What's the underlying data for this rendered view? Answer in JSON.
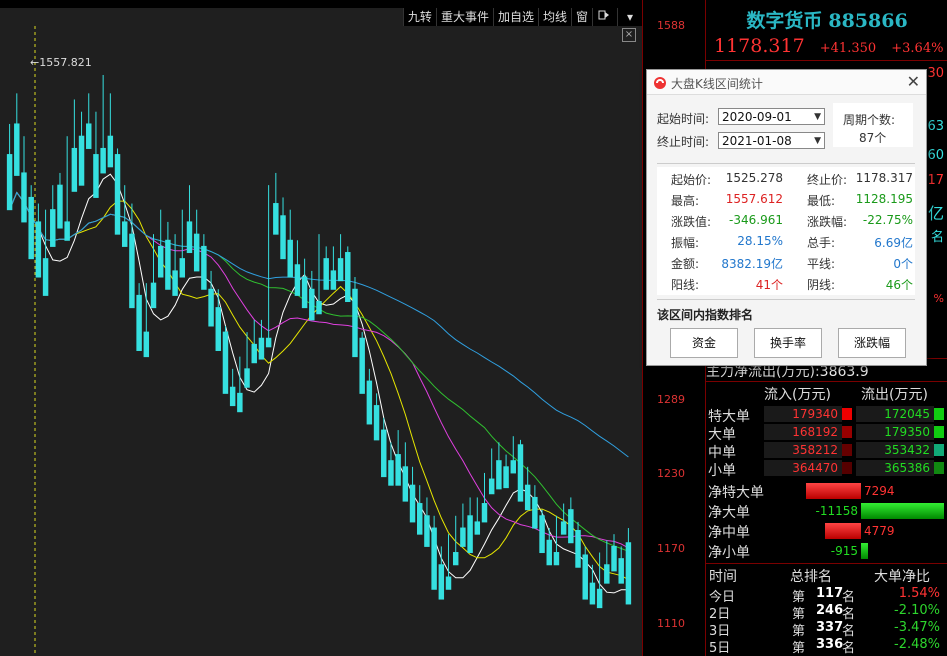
{
  "toolbar": {
    "items": [
      "九转",
      "重大事件",
      "加自选",
      "均线",
      "窗"
    ],
    "icon_more": "arrow-menu-icon",
    "close": "×"
  },
  "chart": {
    "high_marker": "1557.821",
    "price_labels": [
      "1588",
      "1289",
      "1230",
      "1170",
      "1110"
    ],
    "colors": {
      "up": "#ff3030",
      "down": "#36e0e0",
      "ma5": "#ffffff",
      "ma10": "#e6e600",
      "ma20": "#e040e0",
      "ma30": "#30c030",
      "ma60": "#30a0e0"
    }
  },
  "chart_data": {
    "type": "candlestick",
    "ylim": [
      1110,
      1600
    ],
    "yticks": [
      1588,
      1289,
      1230,
      1170,
      1110
    ],
    "annotations": [
      "1557.821"
    ],
    "candles": [
      [
        1495,
        1520,
        1460,
        1450
      ],
      [
        1520,
        1545,
        1500,
        1478
      ],
      [
        1480,
        1510,
        1450,
        1440
      ],
      [
        1460,
        1470,
        1420,
        1410
      ],
      [
        1440,
        1455,
        1405,
        1395
      ],
      [
        1410,
        1450,
        1400,
        1380
      ],
      [
        1450,
        1470,
        1430,
        1420
      ],
      [
        1470,
        1480,
        1440,
        1435
      ],
      [
        1440,
        1510,
        1430,
        1425
      ],
      [
        1500,
        1540,
        1470,
        1465
      ],
      [
        1510,
        1530,
        1475,
        1470
      ],
      [
        1520,
        1545,
        1505,
        1500
      ],
      [
        1495,
        1530,
        1470,
        1460
      ],
      [
        1500,
        1560,
        1490,
        1480
      ],
      [
        1510,
        1545,
        1495,
        1485
      ],
      [
        1495,
        1500,
        1440,
        1430
      ],
      [
        1440,
        1470,
        1430,
        1420
      ],
      [
        1430,
        1455,
        1380,
        1370
      ],
      [
        1380,
        1390,
        1345,
        1335
      ],
      [
        1350,
        1390,
        1340,
        1330
      ],
      [
        1390,
        1430,
        1380,
        1370
      ],
      [
        1420,
        1450,
        1405,
        1395
      ],
      [
        1425,
        1440,
        1395,
        1385
      ],
      [
        1400,
        1430,
        1390,
        1380
      ],
      [
        1410,
        1450,
        1400,
        1395
      ],
      [
        1440,
        1470,
        1420,
        1415
      ],
      [
        1430,
        1450,
        1410,
        1400
      ],
      [
        1420,
        1430,
        1395,
        1385
      ],
      [
        1385,
        1400,
        1370,
        1355
      ],
      [
        1370,
        1385,
        1345,
        1335
      ],
      [
        1350,
        1355,
        1315,
        1300
      ],
      [
        1305,
        1320,
        1300,
        1290
      ],
      [
        1300,
        1330,
        1295,
        1285
      ],
      [
        1320,
        1350,
        1310,
        1305
      ],
      [
        1340,
        1360,
        1330,
        1325
      ],
      [
        1345,
        1360,
        1335,
        1328
      ],
      [
        1345,
        1470,
        1345,
        1338
      ],
      [
        1455,
        1480,
        1435,
        1430
      ],
      [
        1445,
        1460,
        1420,
        1410
      ],
      [
        1425,
        1450,
        1405,
        1395
      ],
      [
        1405,
        1425,
        1390,
        1380
      ],
      [
        1395,
        1410,
        1380,
        1370
      ],
      [
        1385,
        1400,
        1370,
        1360
      ],
      [
        1375,
        1430,
        1370,
        1365
      ],
      [
        1410,
        1420,
        1395,
        1385
      ],
      [
        1400,
        1420,
        1395,
        1385
      ],
      [
        1410,
        1430,
        1400,
        1392
      ],
      [
        1415,
        1420,
        1385,
        1375
      ],
      [
        1385,
        1395,
        1340,
        1330
      ],
      [
        1345,
        1350,
        1310,
        1300
      ],
      [
        1310,
        1320,
        1285,
        1275
      ],
      [
        1290,
        1300,
        1270,
        1262
      ],
      [
        1270,
        1280,
        1240,
        1232
      ],
      [
        1245,
        1260,
        1235,
        1225
      ],
      [
        1250,
        1270,
        1230,
        1225
      ],
      [
        1240,
        1260,
        1220,
        1212
      ],
      [
        1225,
        1240,
        1205,
        1195
      ],
      [
        1210,
        1225,
        1190,
        1185
      ],
      [
        1200,
        1215,
        1185,
        1175
      ],
      [
        1190,
        1200,
        1150,
        1140
      ],
      [
        1160,
        1175,
        1140,
        1132
      ],
      [
        1150,
        1185,
        1145,
        1140
      ],
      [
        1170,
        1200,
        1165,
        1160
      ],
      [
        1190,
        1210,
        1180,
        1175
      ],
      [
        1200,
        1215,
        1180,
        1170
      ],
      [
        1195,
        1215,
        1190,
        1185
      ],
      [
        1210,
        1235,
        1200,
        1195
      ],
      [
        1230,
        1255,
        1225,
        1218
      ],
      [
        1245,
        1260,
        1230,
        1222
      ],
      [
        1240,
        1250,
        1230,
        1223
      ],
      [
        1245,
        1265,
        1240,
        1235
      ],
      [
        1258,
        1262,
        1220,
        1212
      ],
      [
        1225,
        1240,
        1210,
        1205
      ],
      [
        1215,
        1225,
        1195,
        1190
      ],
      [
        1200,
        1205,
        1175,
        1170
      ],
      [
        1180,
        1190,
        1165,
        1160
      ],
      [
        1170,
        1200,
        1165,
        1160
      ],
      [
        1195,
        1210,
        1190,
        1185
      ],
      [
        1205,
        1215,
        1185,
        1178
      ],
      [
        1188,
        1195,
        1165,
        1158
      ],
      [
        1168,
        1175,
        1140,
        1132
      ],
      [
        1145,
        1160,
        1135,
        1128
      ],
      [
        1140,
        1170,
        1130,
        1125
      ],
      [
        1160,
        1180,
        1150,
        1145
      ],
      [
        1175,
        1185,
        1160,
        1155
      ],
      [
        1165,
        1175,
        1150,
        1145
      ],
      [
        1178,
        1190,
        1130,
        1128
      ]
    ]
  },
  "right": {
    "stock_name": "数字货币",
    "stock_code": "885866",
    "last_price": "1178.317",
    "change_abs": "+41.350",
    "change_pct": "+3.64%",
    "partial_values": [
      {
        "text": "30",
        "color": "#ff3333"
      },
      {
        "text": "363",
        "color": "#36e0e0"
      },
      {
        "text": "60",
        "color": "#36e0e0"
      },
      {
        "text": "17",
        "color": "#ff3333"
      },
      {
        "text": "亿",
        "color": "#36e0e0"
      },
      {
        "text": "名",
        "color": "#36e0e0"
      },
      {
        "text": "%",
        "color": "#ff3333"
      }
    ],
    "main_flow_label": "主力净流出(万元)",
    "main_flow_value": "3863.9",
    "flow_headers": [
      "流入(万元)",
      "流出(万元)"
    ],
    "flow_rows": [
      {
        "label": "特大单",
        "in": "179340",
        "out": "172045"
      },
      {
        "label": "大单",
        "in": "168192",
        "out": "179350"
      },
      {
        "label": "中单",
        "in": "358212",
        "out": "353432"
      },
      {
        "label": "小单",
        "in": "364470",
        "out": "365386"
      }
    ],
    "net_rows": [
      {
        "label": "净特大单",
        "value": "7294",
        "sign": "pos",
        "bar": 55
      },
      {
        "label": "净大单",
        "value": "-11158",
        "sign": "neg",
        "bar": 88
      },
      {
        "label": "净中单",
        "value": "4779",
        "sign": "pos",
        "bar": 36
      },
      {
        "label": "净小单",
        "value": "-915",
        "sign": "neg",
        "bar": 7
      }
    ],
    "rank_headers": [
      "时间",
      "总排名",
      "大单净比"
    ],
    "rank_rows": [
      {
        "day": "今日",
        "prefix": "第",
        "rank": "117",
        "suffix": "名",
        "ratio": "1.54%",
        "ratio_color": "#ff3333"
      },
      {
        "day": "2日",
        "prefix": "第",
        "rank": "246",
        "suffix": "名",
        "ratio": "-2.10%",
        "ratio_color": "#2dd52d"
      },
      {
        "day": "3日",
        "prefix": "第",
        "rank": "337",
        "suffix": "名",
        "ratio": "-3.47%",
        "ratio_color": "#2dd52d"
      },
      {
        "day": "5日",
        "prefix": "第",
        "rank": "336",
        "suffix": "名",
        "ratio": "-2.48%",
        "ratio_color": "#2dd52d"
      }
    ]
  },
  "dialog": {
    "title": "大盘K线区间统计",
    "start_label": "起始时间:",
    "start_value": "2020-09-01",
    "end_label": "终止时间:",
    "end_value": "2021-01-08",
    "count_label": "周期个数:",
    "count_value": "87个",
    "stats": [
      {
        "l1": "起始价:",
        "v1": "1525.278",
        "c1": "#333333",
        "l2": "终止价:",
        "v2": "1178.317",
        "c2": "#333333"
      },
      {
        "l1": "最高:",
        "v1": "1557.612",
        "c1": "#dd2222",
        "l2": "最低:",
        "v2": "1128.195",
        "c2": "#1a9a1a"
      },
      {
        "l1": "涨跌值:",
        "v1": "-346.961",
        "c1": "#1a9a1a",
        "l2": "涨跌幅:",
        "v2": "-22.75%",
        "c2": "#1a9a1a"
      },
      {
        "l1": "振幅:",
        "v1": "28.15%",
        "c1": "#2277cc",
        "l2": "总手:",
        "v2": "6.69亿",
        "c2": "#2277cc"
      },
      {
        "l1": "金额:",
        "v1": "8382.19亿",
        "c1": "#2277cc",
        "l2": "平线:",
        "v2": "0个",
        "c2": "#2277cc"
      },
      {
        "l1": "阳线:",
        "v1": "41个",
        "c1": "#dd2222",
        "l2": "阴线:",
        "v2": "46个",
        "c2": "#1a9a1a"
      }
    ],
    "rank_title": "该区间内指数排名",
    "buttons": [
      "资金",
      "换手率",
      "涨跌幅"
    ]
  }
}
